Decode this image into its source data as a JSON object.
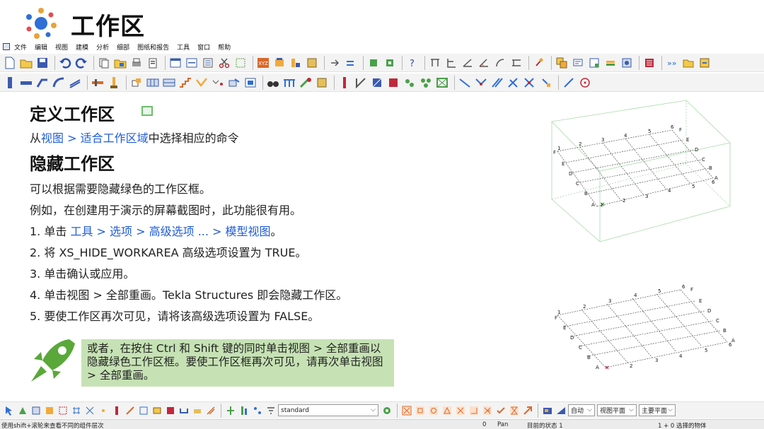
{
  "header": {
    "title": "工作区"
  },
  "menu": {
    "items": [
      "文件",
      "编辑",
      "视图",
      "建模",
      "分析",
      "细部",
      "图纸和报告",
      "工具",
      "窗口",
      "帮助"
    ]
  },
  "content": {
    "define_heading": "定义工作区",
    "define_line": {
      "prefix": "从",
      "link": "视图 > 适合工作区域",
      "suffix": "中选择相应的命令"
    },
    "hide_heading": "隐藏工作区",
    "para1": "可以根据需要隐藏绿色的工作区框。",
    "para2": "例如，在创建用于演示的屏幕截图时，此功能很有用。",
    "step1": {
      "prefix": "1. 单击 ",
      "link": "工具 > 选项 > 高级选项 ... > 模型视图",
      "suffix": "。"
    },
    "step2": "2. 将 XS_HIDE_WORKAREA 高级选项设置为 TRUE。",
    "step3": "3. 单击确认或应用。",
    "step4": "4. 单击视图 > 全部重画。Tekla Structures 即会隐藏工作区。",
    "step5": "5. 要使工作区再次可见，请将该高级选项设置为 FALSE。",
    "tip": "或者，在按住 Ctrl 和 Shift 键的同时单击视图 > 全部重画以隐藏绿色工作区框。要使工作区框再次可见，请再次单击视图 > 全部重画。"
  },
  "grid_labels": {
    "numbers": [
      "1",
      "2",
      "3",
      "4",
      "5",
      "6"
    ],
    "letters": [
      "A",
      "B",
      "C",
      "D",
      "E",
      "F"
    ]
  },
  "bottombar": {
    "select_value": "standard",
    "auto_value": "自动",
    "view_plane_value": "视图平面",
    "main_plane_value": "主要平面"
  },
  "status": {
    "hint": "使用shift+滚轮来查看不同的组件层次",
    "zero": "0",
    "pan": "Pan",
    "current_state": "目前的状态 1",
    "selected": "1 + 0 选择的物体"
  },
  "colors": {
    "link": "#1f5cd9",
    "tip_bg": "#c6e2b4",
    "rocket": "#5aa83a",
    "workarea": "#6bbf6b"
  }
}
